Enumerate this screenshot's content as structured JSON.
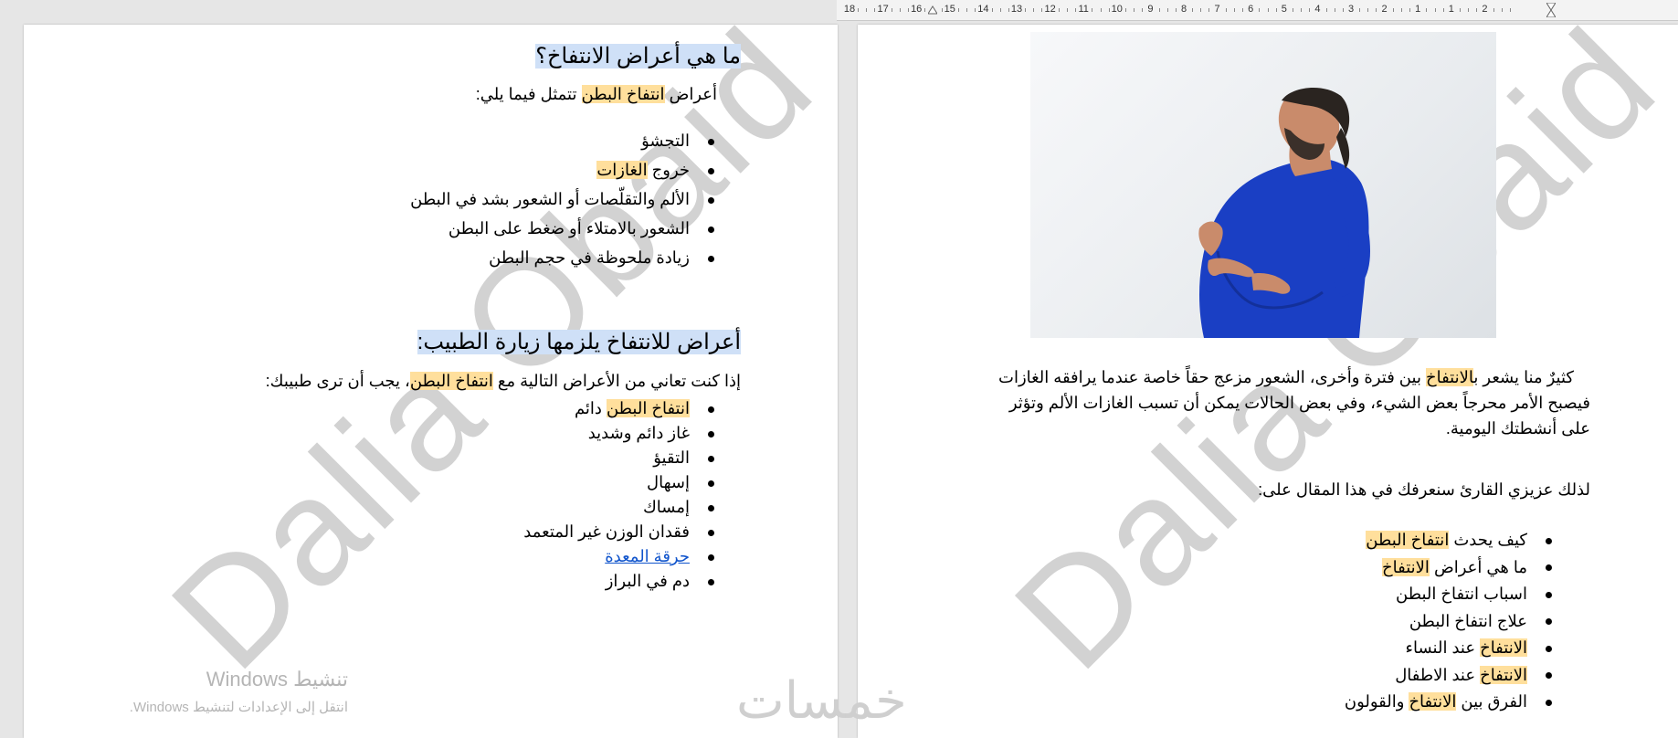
{
  "ruler": {
    "labels": [
      "18",
      "17",
      "16",
      "15",
      "14",
      "13",
      "12",
      "11",
      "10",
      "9",
      "8",
      "7",
      "6",
      "5",
      "4",
      "3",
      "2",
      "1",
      "1",
      "2"
    ]
  },
  "watermark": "Dalia Obaid",
  "left_page": {
    "heading1": "ما هي أعراض الانتفاخ؟",
    "intro": {
      "pre": "أعراض ",
      "highlight": "انتفاخ البطن",
      "post": " تتمثل فيما يلي:"
    },
    "symptoms": [
      {
        "pre": "التجشؤ",
        "hl": "",
        "post": ""
      },
      {
        "pre": "خروج ",
        "hl": "الغازات",
        "post": ""
      },
      {
        "pre": "الألم والتقلّصات أو الشعور بشد في البطن",
        "hl": "",
        "post": ""
      },
      {
        "pre": "الشعور بالامتلاء أو ضغط على البطن",
        "hl": "",
        "post": ""
      },
      {
        "pre": "زيادة ملحوظة في حجم البطن",
        "hl": "",
        "post": ""
      }
    ],
    "heading2": "أعراض للانتفاخ يلزمها زيارة الطبيب:",
    "doctor_intro": {
      "pre": "إذا كنت تعاني من الأعراض التالية مع ",
      "highlight": "انتفاخ البطن",
      "post": "، يجب أن ترى طبيبك:"
    },
    "doctor_list": [
      {
        "hl": "انتفاخ البطن",
        "post": " دائم"
      },
      {
        "hl": "",
        "post": "غاز دائم وشديد"
      },
      {
        "hl": "",
        "post": "التقيؤ"
      },
      {
        "hl": "",
        "post": "إسهال"
      },
      {
        "hl": "",
        "post": "إمساك"
      },
      {
        "hl": "",
        "post": "فقدان الوزن غير المتعمد"
      },
      {
        "hl": "",
        "post": "حرقة المعدة",
        "link": true
      },
      {
        "hl": "",
        "post": "دم في البراز"
      }
    ]
  },
  "right_page": {
    "paragraph_lines": [
      {
        "pre": "كثيرٌ منا يشعر ب",
        "hl": "الانتفاخ",
        "post": " بين فترة وأخرى، الشعور مزعج حقاً خاصة عندما يرافقه الغازات"
      },
      {
        "pre": "فيصبح الأمر محرجاً بعض الشيء، وفي بعض الحالات يمكن أن تسبب الغازات الألم وتؤثر",
        "hl": "",
        "post": ""
      },
      {
        "pre": "على أنشطتك اليومية.",
        "hl": "",
        "post": ""
      }
    ],
    "toc_intro": "لذلك عزيزي القارئ سنعرفك في هذا المقال على:",
    "toc_items": [
      {
        "pre": "كيف يحدث ",
        "hl": "انتفاخ البطن",
        "post": ""
      },
      {
        "pre": "ما هي أعراض ",
        "hl": "الانتفاخ",
        "post": ""
      },
      {
        "pre": "اسباب انتفاخ البطن",
        "hl": "",
        "post": ""
      },
      {
        "pre": "علاج انتفاخ البطن",
        "hl": "",
        "post": ""
      },
      {
        "pre": "",
        "hl": "الانتفاخ",
        "post": " عند النساء"
      },
      {
        "pre": "",
        "hl": "الانتفاخ",
        "post": " عند الاطفال"
      },
      {
        "pre": "الفرق بين ",
        "hl": "الانتفاخ",
        "post": " والقولون"
      }
    ]
  },
  "windows_activation": {
    "title": "تنشيط Windows",
    "subtitle": "انتقل إلى الإعدادات لتنشيط Windows."
  },
  "footer_logo": "خمسات",
  "colors": {
    "highlight_yellow": "#ffdf9c",
    "highlight_blue": "#cfe0f7",
    "link": "#1155cc",
    "shirt": "#1a3fc4"
  }
}
